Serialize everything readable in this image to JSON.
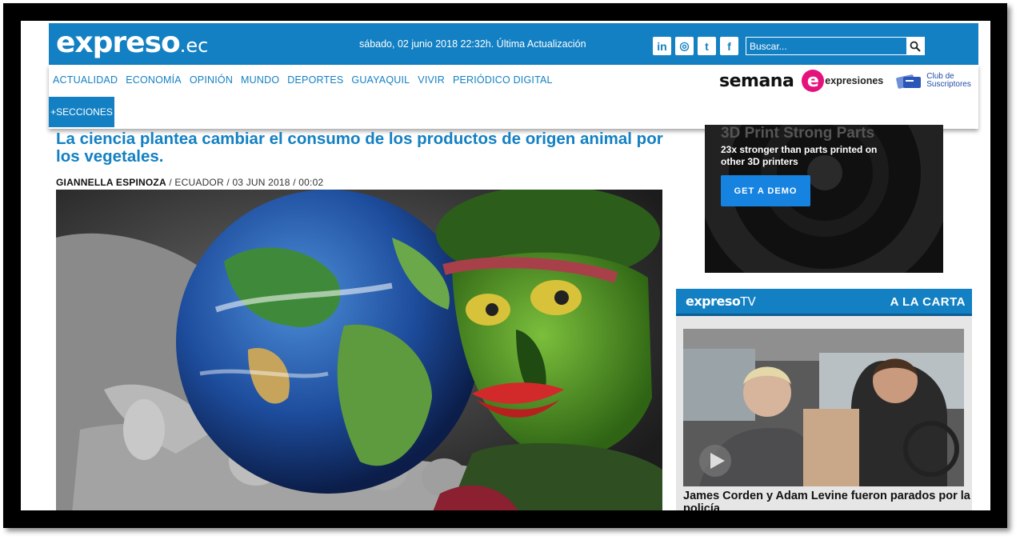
{
  "header": {
    "logo_main": "expreso",
    "logo_suffix": ".ec",
    "date_text": "sábado, 02 junio 2018  22:32h. Última Actualización",
    "social": [
      {
        "label": "in",
        "icon": "linkedin-icon"
      },
      {
        "label": "◎",
        "icon": "instagram-icon"
      },
      {
        "label": "t",
        "icon": "twitter-icon"
      },
      {
        "label": "f",
        "icon": "facebook-icon"
      }
    ],
    "search_placeholder": "Buscar...",
    "accent_color": "#1380c3"
  },
  "nav": {
    "items": [
      "ACTUALIDAD",
      "ECONOMÍA",
      "OPINIÓN",
      "MUNDO",
      "DEPORTES",
      "GUAYAQUIL",
      "VIVIR",
      "PERIÓDICO DIGITAL"
    ],
    "secciones_label": "+SECCIONES",
    "brand_semana": "semana",
    "brand_expresiones": "expresiones",
    "brand_club": "Club de Suscriptores"
  },
  "article": {
    "title": "La ciencia plantea cambiar el consumo de los productos de origen animal por los vegetales.",
    "author": "GIANNELLA ESPINOZA",
    "byline_rest": " / ECUADOR / 03 JUN 2018 / 00:02"
  },
  "ad": {
    "headline": "3D Print Strong Parts",
    "body": "23x stronger than parts printed on other 3D printers",
    "cta": "GET A DEMO"
  },
  "tv": {
    "logo_main": "expreso",
    "logo_suffix": "TV",
    "section": "A LA CARTA",
    "caption": "James Corden y Adam Levine fueron parados por la policía"
  }
}
